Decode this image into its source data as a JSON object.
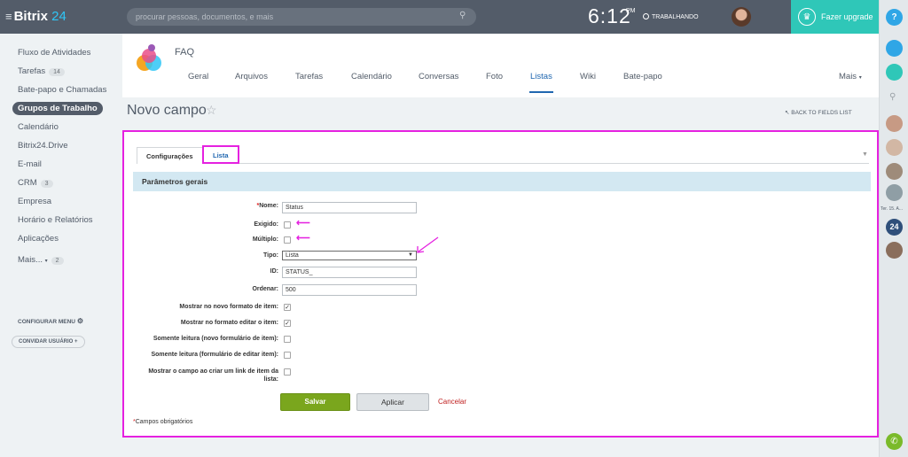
{
  "topbar": {
    "logo_name": "Bitrix",
    "logo_num": "24",
    "search_placeholder": "procurar pessoas, documentos, e mais",
    "clock": "6:12",
    "ampm": "PM",
    "work_status": "TRABALHANDO",
    "upgrade": "Fazer upgrade"
  },
  "sidebar": {
    "items": [
      {
        "label": "Fluxo de Atividades"
      },
      {
        "label": "Tarefas",
        "count": "14"
      },
      {
        "label": "Bate-papo e Chamadas"
      },
      {
        "label": "Grupos de Trabalho"
      },
      {
        "label": "Calendário"
      },
      {
        "label": "Bitrix24.Drive"
      },
      {
        "label": "E-mail"
      },
      {
        "label": "CRM",
        "count": "3"
      },
      {
        "label": "Empresa"
      },
      {
        "label": "Horário e Relatórios"
      },
      {
        "label": "Aplicações"
      },
      {
        "label": "Mais...",
        "count": "2"
      }
    ],
    "config_menu": "CONFIGURAR MENU",
    "invite": "CONVIDAR USUÁRIO"
  },
  "group": {
    "name": "FAQ",
    "tabs": [
      "Geral",
      "Arquivos",
      "Tarefas",
      "Calendário",
      "Conversas",
      "Foto",
      "Listas",
      "Wiki",
      "Bate-papo"
    ],
    "more": "Mais"
  },
  "page": {
    "title": "Novo campo",
    "back": "BACK TO FIELDS LIST"
  },
  "form": {
    "tab1": "Configurações",
    "tab2": "Lista",
    "section": "Parâmetros gerais",
    "name_label": "Nome:",
    "name_value": "Status",
    "required_label": "Exigido:",
    "multiple_label": "Múltiplo:",
    "type_label": "Tipo:",
    "type_value": "Lista",
    "id_label": "ID:",
    "id_value": "STATUS_",
    "order_label": "Ordenar:",
    "order_value": "500",
    "show_new_label": "Mostrar no novo formato de item:",
    "show_edit_label": "Mostrar no formato editar o item:",
    "ro_new_label": "Somente leitura (novo formulário de item):",
    "ro_edit_label": "Somente leitura (formulário de editar item):",
    "show_link_label1": "Mostrar o campo ao criar um link de item da",
    "show_link_label2": "lista:",
    "save": "Salvar",
    "apply": "Aplicar",
    "cancel": "Cancelar",
    "required_note": "Campos obrigatórios"
  },
  "rightbar": {
    "timestamp": "Ter. 15. A..."
  }
}
